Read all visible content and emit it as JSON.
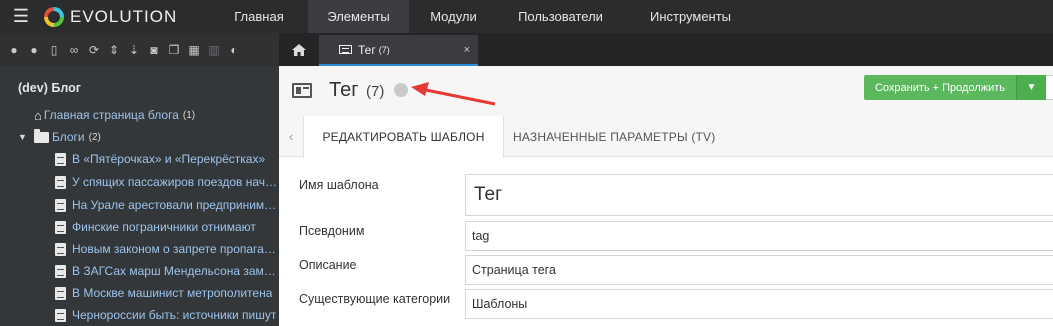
{
  "topbar": {
    "logo_text": "EVOLUTION",
    "nav": [
      "Главная",
      "Элементы",
      "Модули",
      "Пользователи",
      "Инструменты"
    ]
  },
  "sidebar": {
    "toolbar_icons": [
      "arrow-down-circle-icon",
      "arrow-up-circle-icon",
      "file-icon",
      "link-icon",
      "refresh-icon",
      "sort-icon",
      "sort-numeric-icon",
      "camera-icon",
      "copy-icon",
      "grid-icon",
      "trash-icon",
      "contrast-icon"
    ],
    "root": "(dev) Блог",
    "items": [
      {
        "label": "Главная страница блога",
        "count": "(1)",
        "type": "home"
      },
      {
        "label": "Блоги",
        "count": "(2)",
        "type": "folder"
      },
      {
        "label": "В «Пятёрочках» и «Перекрёстках»",
        "type": "doc"
      },
      {
        "label": "У спящих пассажиров поездов начали",
        "type": "doc"
      },
      {
        "label": "На Урале арестовали предпринимателя",
        "type": "doc"
      },
      {
        "label": "Финские пограничники отнимают",
        "type": "doc"
      },
      {
        "label": "Новым законом о запрете пропаганды",
        "type": "doc"
      },
      {
        "label": "В ЗАГСах марш Мендельсона заменят",
        "type": "doc"
      },
      {
        "label": "В Москве машинист метрополитена",
        "type": "doc"
      },
      {
        "label": "Черноросcии быть: источники пишут",
        "type": "doc"
      }
    ]
  },
  "tabstrip": {
    "doc_tab_label": "Тег",
    "doc_tab_count": "(7)",
    "close": "×"
  },
  "main": {
    "title": "Тег",
    "title_count": "(7)",
    "save_label": "Сохранить + Продолжить",
    "tabs": [
      "РЕДАКТИРОВАТЬ ШАБЛОН",
      "НАЗНАЧЕННЫЕ ПАРАМЕТРЫ (TV)"
    ],
    "form": {
      "name_label": "Имя шаблона",
      "name_value": "Тег",
      "alias_label": "Псевдоним",
      "alias_value": "tag",
      "desc_label": "Описание",
      "desc_value": "Страница тега",
      "cat_label": "Существующие категории",
      "cat_value": "Шаблоны"
    }
  },
  "colors": {
    "accent": "#2d8cd8",
    "save_button": "#5cb85c",
    "annotation_arrow": "#e53935"
  }
}
